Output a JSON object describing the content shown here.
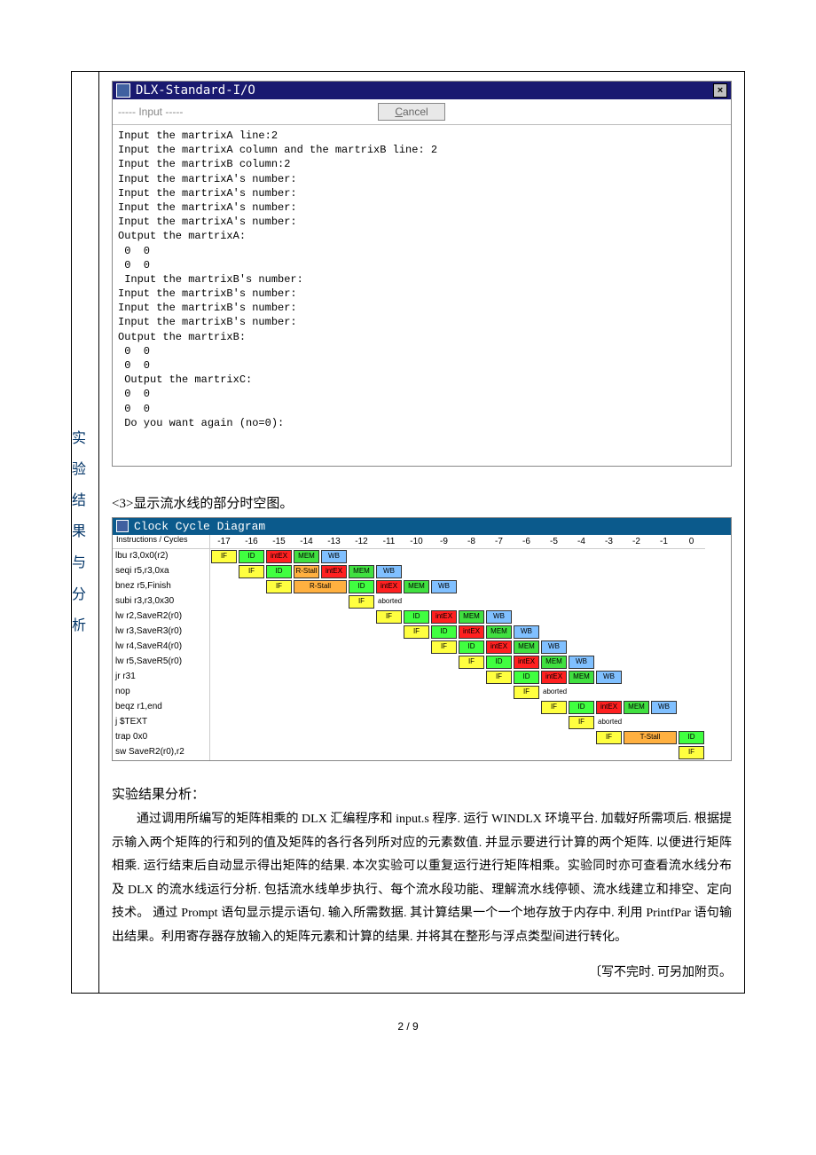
{
  "side_label": "实\n验\n结\n果\n与\n分\n析",
  "io_window": {
    "title": "DLX-Standard-I/O",
    "close": "×",
    "input_label": "----- Input -----",
    "cancel": "Cancel",
    "body": "Input the martrixA line:2\nInput the martrixA column and the martrixB line: 2\nInput the martrixB column:2\nInput the martrixA's number:\nInput the martrixA's number:\nInput the martrixA's number:\nInput the martrixA's number:\nOutput the martrixA:\n 0  0\n 0  0\n Input the martrixB's number:\nInput the martrixB's number:\nInput the martrixB's number:\nInput the martrixB's number:\nOutput the martrixB:\n 0  0\n 0  0\n Output the martrixC:\n 0  0\n 0  0\n Do you want again (no=0):"
  },
  "section3_title": "<3>显示流水线的部分时空图。",
  "ccd": {
    "title": "Clock Cycle Diagram",
    "header_left": "Instructions / Cycles",
    "cycles": [
      "-17",
      "-16",
      "-15",
      "-14",
      "-13",
      "-12",
      "-11",
      "-10",
      "-9",
      "-8",
      "-7",
      "-6",
      "-5",
      "-4",
      "-3",
      "-2",
      "-1",
      "0"
    ],
    "rows": [
      {
        "instr": "lbu r3,0x0(r2)",
        "stages": [
          [
            "IF",
            0
          ],
          [
            "ID",
            1
          ],
          [
            "intEX",
            2
          ],
          [
            "MEM",
            3
          ],
          [
            "WB",
            4
          ]
        ]
      },
      {
        "instr": "seqi r5,r3,0xa",
        "stages": [
          [
            "IF",
            1
          ],
          [
            "ID",
            2
          ],
          [
            "R-Stall",
            3
          ],
          [
            "intEX",
            4
          ],
          [
            "MEM",
            5
          ],
          [
            "WB",
            6
          ]
        ]
      },
      {
        "instr": "bnez r5,Finish",
        "stages": [
          [
            "IF",
            2
          ],
          [
            "R-Stall",
            3,
            2
          ],
          [
            "ID",
            5
          ],
          [
            "intEX",
            6
          ],
          [
            "MEM",
            7
          ],
          [
            "WB",
            8
          ]
        ]
      },
      {
        "instr": "subi r3,r3,0x30",
        "stages": [
          [
            "IF",
            5
          ],
          [
            "aborted",
            6
          ]
        ]
      },
      {
        "instr": "lw r2,SaveR2(r0)",
        "stages": [
          [
            "IF",
            6
          ],
          [
            "ID",
            7
          ],
          [
            "intEX",
            8
          ],
          [
            "MEM",
            9
          ],
          [
            "WB",
            10
          ]
        ]
      },
      {
        "instr": "lw r3,SaveR3(r0)",
        "stages": [
          [
            "IF",
            7
          ],
          [
            "ID",
            8
          ],
          [
            "intEX",
            9
          ],
          [
            "MEM",
            10
          ],
          [
            "WB",
            11
          ]
        ]
      },
      {
        "instr": "lw r4,SaveR4(r0)",
        "stages": [
          [
            "IF",
            8
          ],
          [
            "ID",
            9
          ],
          [
            "intEX",
            10
          ],
          [
            "MEM",
            11
          ],
          [
            "WB",
            12
          ]
        ]
      },
      {
        "instr": "lw r5,SaveR5(r0)",
        "stages": [
          [
            "IF",
            9
          ],
          [
            "ID",
            10
          ],
          [
            "intEX",
            11
          ],
          [
            "MEM",
            12
          ],
          [
            "WB",
            13
          ]
        ]
      },
      {
        "instr": "jr r31",
        "stages": [
          [
            "IF",
            10
          ],
          [
            "ID",
            11
          ],
          [
            "intEX",
            12
          ],
          [
            "MEM",
            13
          ],
          [
            "WB",
            14
          ]
        ]
      },
      {
        "instr": "nop",
        "stages": [
          [
            "IF",
            11
          ],
          [
            "aborted",
            12
          ]
        ]
      },
      {
        "instr": "beqz r1,end",
        "stages": [
          [
            "IF",
            12
          ],
          [
            "ID",
            13
          ],
          [
            "intEX",
            14
          ],
          [
            "MEM",
            15
          ],
          [
            "WB",
            16
          ]
        ]
      },
      {
        "instr": "j $TEXT",
        "stages": [
          [
            "IF",
            13
          ],
          [
            "aborted",
            14
          ]
        ]
      },
      {
        "instr": "trap 0x0",
        "stages": [
          [
            "IF",
            14
          ],
          [
            "T-Stall",
            15,
            2
          ],
          [
            "ID",
            17
          ]
        ]
      },
      {
        "instr": "sw SaveR2(r0),r2",
        "stages": [
          [
            "IF",
            17
          ]
        ]
      }
    ]
  },
  "analysis": {
    "title": "实验结果分析：",
    "body": "通过调用所编写的矩阵相乘的 DLX 汇编程序和 input.s 程序. 运行 WINDLX 环境平台. 加载好所需项后. 根据提示输入两个矩阵的行和列的值及矩阵的各行各列所对应的元素数值. 并显示要进行计算的两个矩阵. 以便进行矩阵相乘. 运行结束后自动显示得出矩阵的结果. 本次实验可以重复运行进行矩阵相乘。实验同时亦可查看流水线分布及 DLX 的流水线运行分析. 包括流水线单步执行、每个流水段功能、理解流水线停顿、流水线建立和排空、定向技术。 通过 Prompt 语句显示提示语句. 输入所需数据. 其计算结果一个一个地存放于内存中. 利用 PrintfPar 语句输出结果。利用寄存器存放输入的矩阵元素和计算的结果. 并将其在整形与浮点类型间进行转化。",
    "footnote": "〔写不完时. 可另加附页。",
    "page_num": "2 / 9"
  }
}
